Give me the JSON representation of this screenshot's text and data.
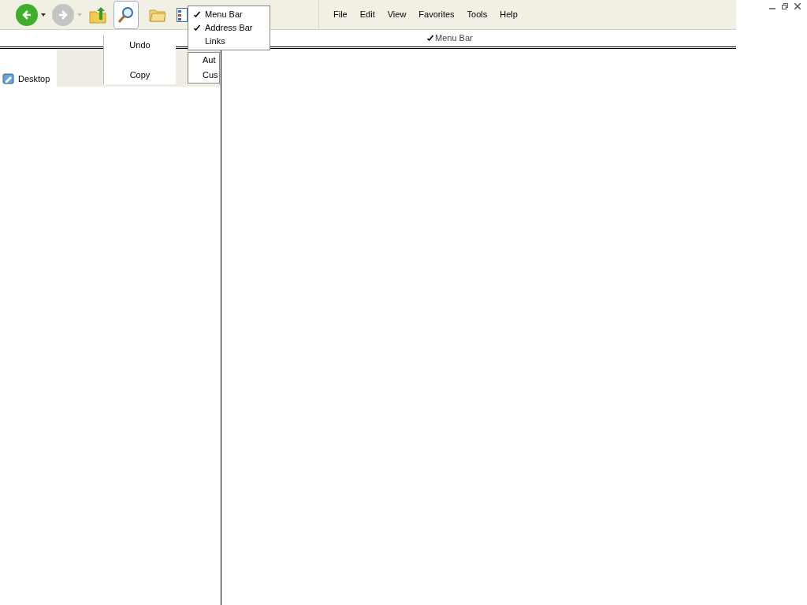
{
  "toolbar": {
    "buttons": [
      {
        "kind": "back",
        "disabled": false
      },
      {
        "kind": "forward",
        "disabled": true
      },
      {
        "kind": "up"
      },
      {
        "kind": "search",
        "pressed": true
      },
      {
        "kind": "folders",
        "pressed": false
      },
      {
        "kind": "views"
      }
    ]
  },
  "menu_bar": [
    "File",
    "Edit",
    "View",
    "Favorites",
    "Tools",
    "Help"
  ],
  "toolbars_menu": [
    {
      "label": "Menu Bar",
      "checked": true
    },
    {
      "label": "Address Bar",
      "checked": true
    },
    {
      "label": "Links",
      "checked": false
    }
  ],
  "toolbars_submenu": [
    "Aut",
    "Cus"
  ],
  "edit_menu": [
    "Undo",
    "Copy"
  ],
  "ghost_item": {
    "label": "Menu Bar",
    "checked": true
  },
  "tree": [
    {
      "label": "Desktop"
    }
  ]
}
